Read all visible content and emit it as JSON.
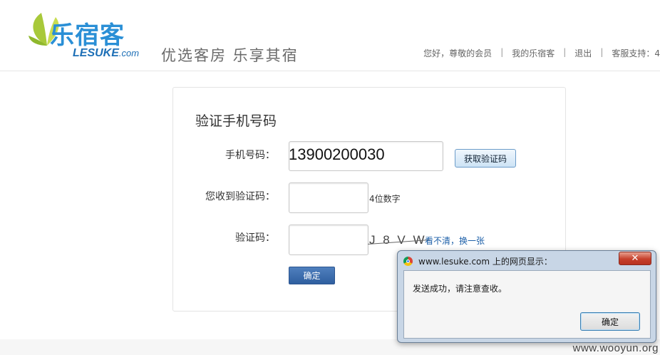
{
  "header": {
    "logo_cn": "乐宿客",
    "logo_en_main": "LESUKE",
    "logo_en_suffix": ".com",
    "slogan": "优选客房 乐享其宿",
    "nav": {
      "greeting": "您好，尊敬的会员",
      "my_account": "我的乐宿客",
      "logout": "退出",
      "support": "客服支持：4",
      "separator": "|"
    }
  },
  "form": {
    "title": "验证手机号码",
    "phone_label": "手机号码：",
    "phone_value": "13900200030",
    "get_code_label": "获取验证码",
    "received_code_label": "您收到验证码：",
    "received_code_hint": "4位数字",
    "captcha_label": "验证码：",
    "captcha_text": "J 8 V W",
    "refresh_captcha_label": "看不清，换一张",
    "submit_label": "确定"
  },
  "dialog": {
    "title": "www.lesuke.com 上的网页显示：",
    "close_glyph": "✕",
    "message": "发送成功，请注意查收。",
    "ok_label": "确定"
  },
  "watermark": "www.wooyun.org",
  "colors": {
    "brand_blue": "#2a8fd6",
    "submit_blue": "#2f5f9f",
    "link_blue": "#1c5fa8",
    "close_red": "#c6402c"
  }
}
